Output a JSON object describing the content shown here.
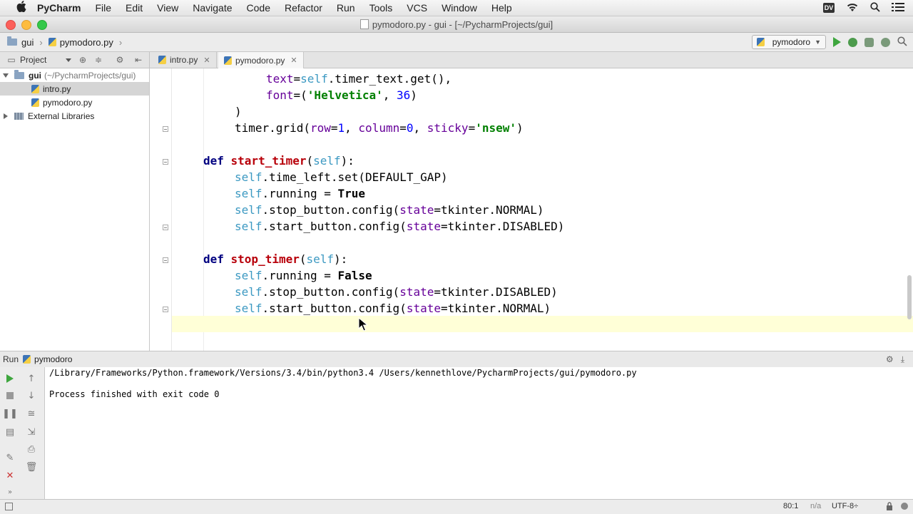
{
  "menubar": {
    "app": "PyCharm",
    "items": [
      "File",
      "Edit",
      "View",
      "Navigate",
      "Code",
      "Refactor",
      "Run",
      "Tools",
      "VCS",
      "Window",
      "Help"
    ],
    "status_badge": "DV"
  },
  "window": {
    "title": "pymodoro.py - gui - [~/PycharmProjects/gui]"
  },
  "navbar": {
    "breadcrumb_folder": "gui",
    "breadcrumb_file": "pymodoro.py",
    "run_config": "pymodoro"
  },
  "project_panel": {
    "header": "Project",
    "root_label": "gui",
    "root_path": "(~/PycharmProjects/gui)",
    "files": [
      "intro.py",
      "pymodoro.py"
    ],
    "external": "External Libraries"
  },
  "tabs": [
    {
      "label": "intro.py"
    },
    {
      "label": "pymodoro.py"
    }
  ],
  "editor": {
    "lines": {
      "l1": "text=self.timer_text.get(),",
      "l2": "font=('Helvetica', 36)",
      "l3": ")",
      "l4": "timer.grid(row=1, column=0, sticky='nsew')",
      "l5": "def start_timer(self):",
      "l6": "self.time_left.set(DEFAULT_GAP)",
      "l7": "self.running = True",
      "l8": "self.stop_button.config(state=tkinter.NORMAL)",
      "l9": "self.start_button.config(state=tkinter.DISABLED)",
      "l10": "def stop_timer(self):",
      "l11": "self.running = False",
      "l12": "self.stop_button.config(state=tkinter.DISABLED)",
      "l13": "self.start_button.config(state=tkinter.NORMAL)"
    }
  },
  "run_panel": {
    "label": "Run",
    "config": "pymodoro",
    "output": [
      "/Library/Frameworks/Python.framework/Versions/3.4/bin/python3.4 /Users/kennethlove/PycharmProjects/gui/pymodoro.py",
      "",
      "Process finished with exit code 0"
    ]
  },
  "statusbar": {
    "position": "80:1",
    "na": "n/a",
    "encoding": "UTF-8÷"
  },
  "colors": {
    "keyword": "#000080",
    "function_name": "#b8000a",
    "self": "#94558d",
    "string": "#008000",
    "number": "#0000ff",
    "current_line": "#ffffd7"
  }
}
